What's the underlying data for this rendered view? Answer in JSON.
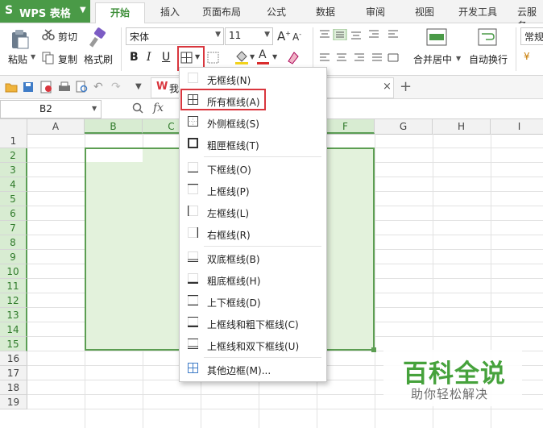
{
  "app": {
    "name": "WPS 表格",
    "logo_letter": "S"
  },
  "tabs": [
    "开始",
    "插入",
    "页面布局",
    "公式",
    "数据",
    "审阅",
    "视图",
    "开发工具",
    "云服务"
  ],
  "ribbon": {
    "paste": "粘贴",
    "cut": "剪切",
    "copy": "复制",
    "format_painter": "格式刷",
    "font_name": "宋体",
    "font_size": "11",
    "bold": "B",
    "italic": "I",
    "underline": "U",
    "font_color_letter": "A",
    "merge_center": "合并居中",
    "wrap_text": "自动换行",
    "number_format": "常规"
  },
  "doc_tab": {
    "title": "我"
  },
  "formula_bar": {
    "name_box": "B2",
    "fx": "fx"
  },
  "columns": [
    "A",
    "B",
    "C",
    "D",
    "E",
    "F",
    "G",
    "H",
    "I"
  ],
  "rows": [
    "1",
    "2",
    "3",
    "4",
    "5",
    "6",
    "7",
    "8",
    "9",
    "10",
    "11",
    "12",
    "13",
    "14",
    "15",
    "16",
    "17",
    "18",
    "19"
  ],
  "menu": {
    "items": [
      "无框线(N)",
      "所有框线(A)",
      "外侧框线(S)",
      "粗匣框线(T)",
      "下框线(O)",
      "上框线(P)",
      "左框线(L)",
      "右框线(R)",
      "双底框线(B)",
      "粗底框线(H)",
      "上下框线(D)",
      "上框线和粗下框线(C)",
      "上框线和双下框线(U)",
      "其他边框(M)..."
    ]
  },
  "watermark": {
    "title": "百科全说",
    "subtitle": "助你轻松解决"
  },
  "colors": {
    "accent_green": "#4a9a47",
    "selection_fill": "#e3f2dc",
    "highlight_red": "#d9363e"
  }
}
